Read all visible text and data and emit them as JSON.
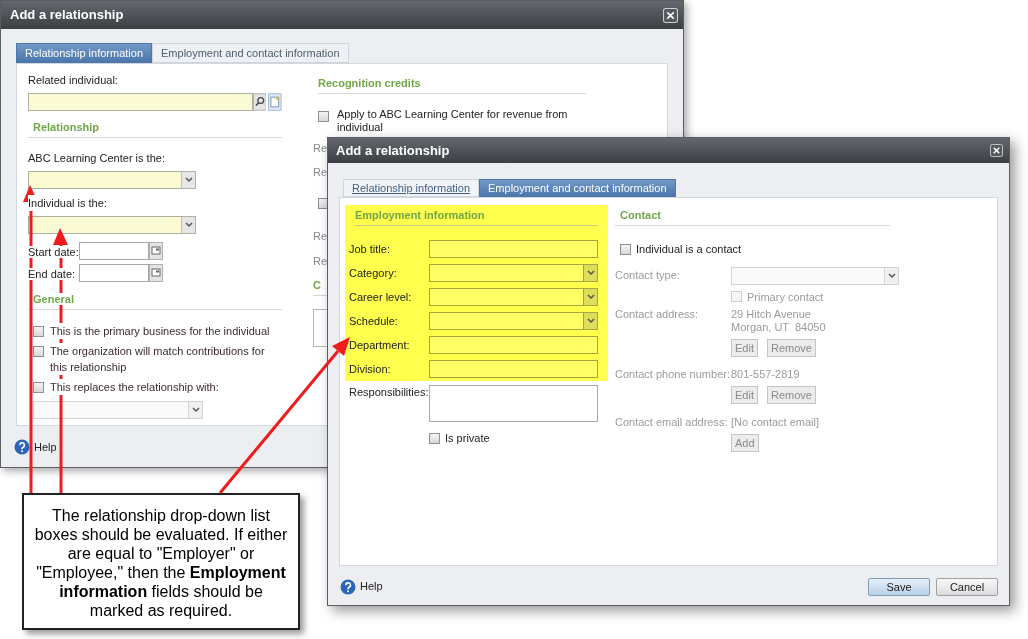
{
  "back_dialog": {
    "title": "Add a relationship",
    "tabs": [
      {
        "label": "Relationship information",
        "selected": true
      },
      {
        "label": "Employment and contact information",
        "selected": false
      }
    ],
    "related_individual": {
      "label": "Related individual:",
      "required": true
    },
    "relationship": {
      "heading": "Relationship",
      "fields": [
        {
          "label": "ABC Learning Center is the:",
          "kind": "dropdown",
          "required": true
        },
        {
          "label": "Individual is the:",
          "kind": "dropdown",
          "required": true
        },
        {
          "label": "Start date:",
          "kind": "date",
          "required": false
        },
        {
          "label": "End date:",
          "kind": "date",
          "required": false
        }
      ]
    },
    "general": {
      "heading": "General",
      "options": [
        {
          "label": "This is the primary business for the individual",
          "checked": false
        },
        {
          "label": "The organization will match contributions for this relationship",
          "checked": false
        },
        {
          "label": "This replaces the relationship with:",
          "checked": false
        }
      ],
      "replaced_dropdown": {
        "disabled": true
      }
    },
    "recognition": {
      "heading": "Recognition credits",
      "apply": {
        "label": "Apply to ABC Learning Center for revenue from individual",
        "checked": false
      },
      "cut_rows": [
        {
          "kind": "label",
          "text": "Re"
        },
        {
          "kind": "label",
          "text": "Re"
        },
        {
          "kind": "checkbox",
          "checked": false
        },
        {
          "kind": "label",
          "text": "Re"
        },
        {
          "kind": "label",
          "text": "Re"
        },
        {
          "kind": "heading",
          "text": "C"
        },
        {
          "kind": "box"
        }
      ]
    },
    "help": "Help"
  },
  "front_dialog": {
    "title": "Add a relationship",
    "tabs": [
      {
        "label": "Relationship information",
        "selected": false
      },
      {
        "label": "Employment and contact information",
        "selected": true
      }
    ],
    "employment": {
      "heading": "Employment information",
      "highlighted": true,
      "fields": [
        {
          "label": "Job title:",
          "kind": "text"
        },
        {
          "label": "Category:",
          "kind": "dropdown"
        },
        {
          "label": "Career level:",
          "kind": "dropdown"
        },
        {
          "label": "Schedule:",
          "kind": "dropdown"
        },
        {
          "label": "Department:",
          "kind": "text"
        },
        {
          "label": "Division:",
          "kind": "text"
        }
      ],
      "responsibilities": {
        "label": "Responsibilities:"
      },
      "private": {
        "label": "Is private",
        "checked": false
      }
    },
    "contact": {
      "heading": "Contact",
      "is_contact": {
        "label": "Individual is a contact",
        "checked": false
      },
      "rows": [
        {
          "kind": "dropdown",
          "label": "Contact type:",
          "disabled": true
        },
        {
          "kind": "checkbox",
          "label": "Primary contact",
          "checked": false,
          "disabled": true
        },
        {
          "kind": "info",
          "label": "Contact address:",
          "lines": [
            "29 Hitch Avenue",
            "Morgan, UT  84050"
          ],
          "buttons": [
            "Edit",
            "Remove"
          ],
          "disabled": true
        },
        {
          "kind": "info",
          "label": "Contact phone number:",
          "lines": [
            "801-557-2819"
          ],
          "buttons": [
            "Edit",
            "Remove"
          ],
          "disabled": true
        },
        {
          "kind": "info",
          "label": "Contact email address:",
          "lines": [
            "[No contact email]"
          ],
          "buttons": [
            "Add"
          ],
          "disabled": true
        }
      ]
    },
    "help": "Help",
    "buttons": [
      {
        "label": "Save",
        "primary": true
      },
      {
        "label": "Cancel",
        "primary": false
      }
    ]
  },
  "callout": {
    "text": "The relationship drop-down list boxes should be evaluated. If either are equal to \"Employer\" or \"Employee,\" then the **Employment information** fields should be marked as required."
  }
}
